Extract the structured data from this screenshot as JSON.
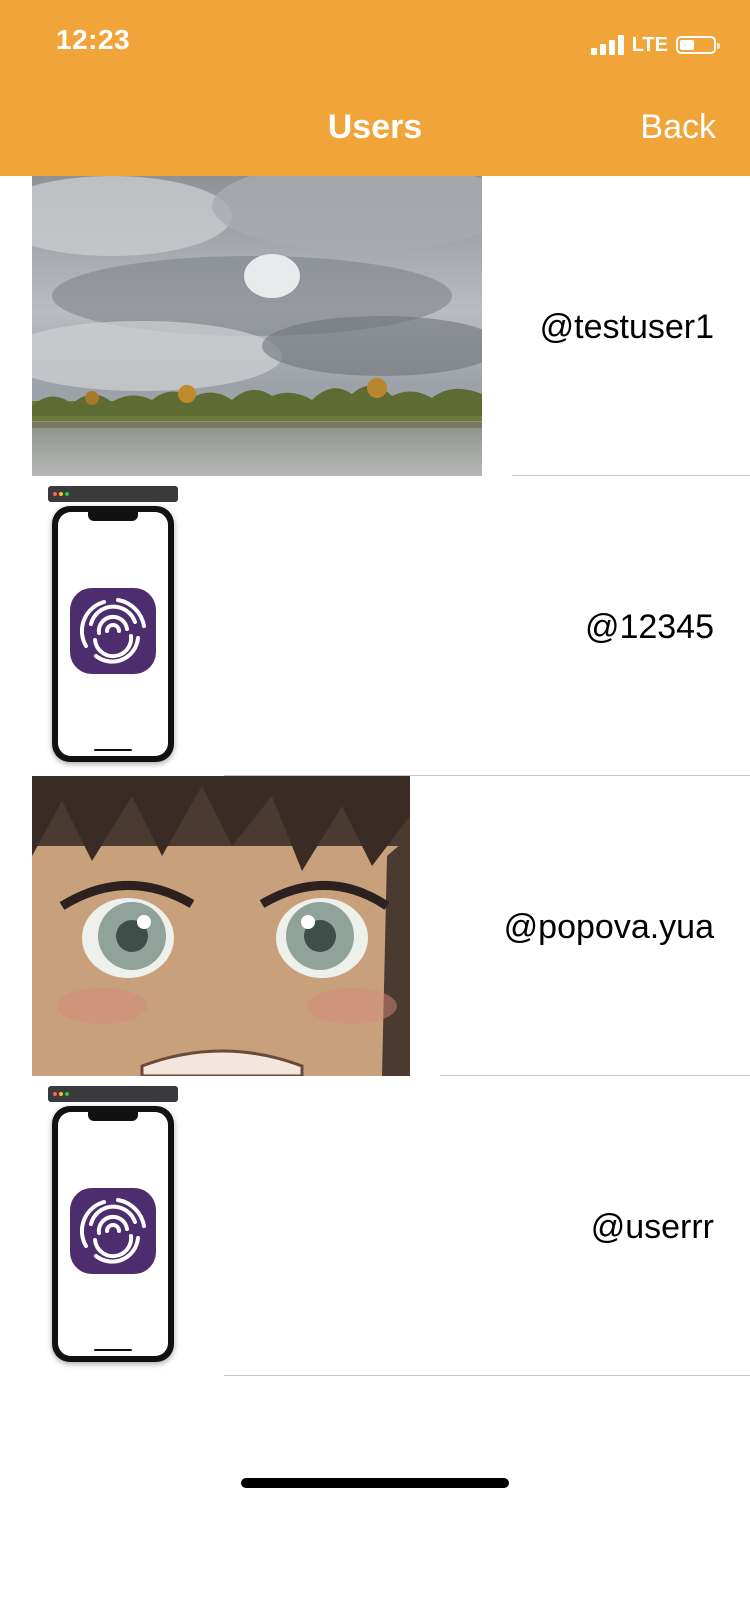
{
  "status_bar": {
    "time": "12:23",
    "network": "LTE"
  },
  "navbar": {
    "title": "Users",
    "back_label": "Back"
  },
  "users": [
    {
      "handle": "@testuser1",
      "avatar": "landscape-photo"
    },
    {
      "handle": "@12345",
      "avatar": "app-screenshot"
    },
    {
      "handle": "@popova.yua",
      "avatar": "anime-face"
    },
    {
      "handle": "@userrr",
      "avatar": "app-screenshot"
    }
  ],
  "colors": {
    "navbar": "#F0A43A",
    "separator": "#c6c6c8",
    "app_icon": "#4E2D6E"
  }
}
